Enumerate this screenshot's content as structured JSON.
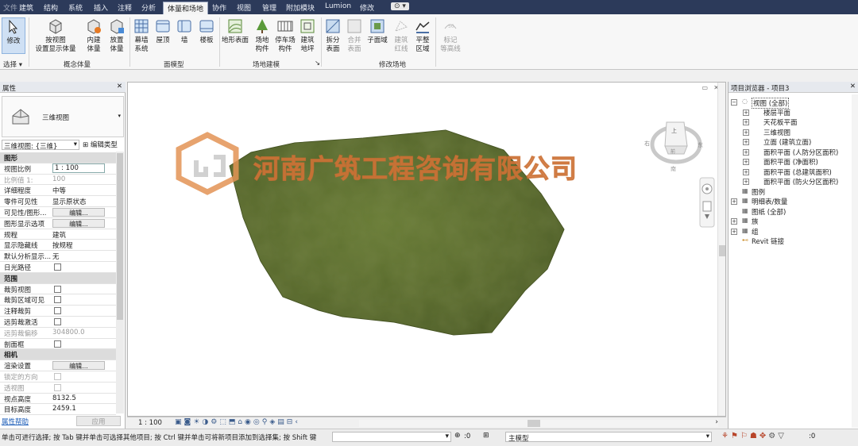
{
  "menu": {
    "items": [
      "文件",
      "建筑",
      "结构",
      "系统",
      "插入",
      "注释",
      "分析",
      "体量和场地",
      "协作",
      "视图",
      "管理",
      "附加模块",
      "Lumion",
      "修改"
    ],
    "active": "体量和场地"
  },
  "ribbon": {
    "modify": "修改",
    "select": "选择",
    "buttons": {
      "show_mass": "按视图\n设置显示体量",
      "inplace_mass": "内建\n体量",
      "place_mass": "放置\n体量",
      "curtain_system": "幕墙\n系统",
      "roof": "屋顶",
      "wall": "墙",
      "floor": "楼板",
      "toposurface": "地形表面",
      "site_component": "场地\n构件",
      "parking_component": "停车场\n构件",
      "building_pad": "建筑\n地坪",
      "split_surface": "拆分\n表面",
      "merge_surface": "合并\n表面",
      "subregion": "子面域",
      "property_line": "建筑\n红线",
      "graded_region": "平整\n区域",
      "label_contours": "标记\n等高线"
    },
    "groups": {
      "conceptual_mass": "概念体量",
      "model_by_face": "面模型",
      "site_modeling": "场地建模",
      "modify_site": "修改场地"
    }
  },
  "properties": {
    "title": "属性",
    "type_name": "三维视图",
    "selector": "三维视图: {三维}",
    "edit_type": "编辑类型",
    "rows": [
      {
        "kind": "cat",
        "k": "图形"
      },
      {
        "kind": "input",
        "k": "视图比例",
        "v": "1 : 100"
      },
      {
        "kind": "dim",
        "k": "比例值 1:",
        "v": "100"
      },
      {
        "kind": "text",
        "k": "详细程度",
        "v": "中等"
      },
      {
        "kind": "text",
        "k": "零件可见性",
        "v": "显示原状态"
      },
      {
        "kind": "btn",
        "k": "可见性/图形...",
        "v": "编辑..."
      },
      {
        "kind": "btn",
        "k": "图形显示选项",
        "v": "编辑..."
      },
      {
        "kind": "text",
        "k": "规程",
        "v": "建筑"
      },
      {
        "kind": "text",
        "k": "显示隐藏线",
        "v": "按规程"
      },
      {
        "kind": "text",
        "k": "默认分析显示...",
        "v": "无"
      },
      {
        "kind": "cb",
        "k": "日光路径"
      },
      {
        "kind": "cat",
        "k": "范围"
      },
      {
        "kind": "cb",
        "k": "裁剪视图"
      },
      {
        "kind": "cb",
        "k": "裁剪区域可见"
      },
      {
        "kind": "cb",
        "k": "注释裁剪"
      },
      {
        "kind": "cb",
        "k": "远剪裁激活"
      },
      {
        "kind": "dim",
        "k": "远剪裁偏移",
        "v": "304800.0"
      },
      {
        "kind": "cb",
        "k": "剖面框"
      },
      {
        "kind": "cat",
        "k": "相机"
      },
      {
        "kind": "btn",
        "k": "渲染设置",
        "v": "编辑..."
      },
      {
        "kind": "dimcb",
        "k": "锁定的方向"
      },
      {
        "kind": "dimcb",
        "k": "透视图"
      },
      {
        "kind": "text",
        "k": "视点高度",
        "v": "8132.5"
      },
      {
        "kind": "text",
        "k": "目标高度",
        "v": "2459.1"
      }
    ],
    "help": "属性帮助",
    "apply": "应用"
  },
  "view": {
    "watermark": "河南广筑工程咨询有限公司",
    "scale": "1 : 100",
    "viewcube": {
      "top": "上",
      "left": "右",
      "front": "前",
      "right": "东",
      "bottom": "南"
    }
  },
  "browser": {
    "title": "项目浏览器 - 项目3",
    "nodes": [
      {
        "t": "视图 (全部)",
        "lvl": 0,
        "tog": "-"
      },
      {
        "t": "楼层平面",
        "lvl": 1,
        "tog": "+"
      },
      {
        "t": "天花板平面",
        "lvl": 1,
        "tog": "+"
      },
      {
        "t": "三维视图",
        "lvl": 1,
        "tog": "+"
      },
      {
        "t": "立面 (建筑立面)",
        "lvl": 1,
        "tog": "+"
      },
      {
        "t": "面积平面 (人防分区面积)",
        "lvl": 1,
        "tog": "+"
      },
      {
        "t": "面积平面 (净面积)",
        "lvl": 1,
        "tog": "+"
      },
      {
        "t": "面积平面 (总建筑面积)",
        "lvl": 1,
        "tog": "+"
      },
      {
        "t": "面积平面 (防火分区面积)",
        "lvl": 1,
        "tog": "+"
      },
      {
        "t": "图例",
        "lvl": 0,
        "tog": ""
      },
      {
        "t": "明细表/数量",
        "lvl": 0,
        "tog": "+"
      },
      {
        "t": "图纸 (全部)",
        "lvl": 0,
        "tog": ""
      },
      {
        "t": "族",
        "lvl": 0,
        "tog": "+"
      },
      {
        "t": "组",
        "lvl": 0,
        "tog": "+"
      },
      {
        "t": "Revit 链接",
        "lvl": 0,
        "tog": ""
      }
    ]
  },
  "status": {
    "message": "单击可进行选择; 按 Tab 键并单击可选择其他项目; 按 Ctrl 键并单击可将新项目添加到选择集; 按 Shift 键",
    "count": ":0",
    "model": "主模型",
    "filter": ":0"
  },
  "colors": {
    "menubar": "#2c3a5a",
    "terrain": "#5b6b2e",
    "watermark": "#e39455"
  }
}
